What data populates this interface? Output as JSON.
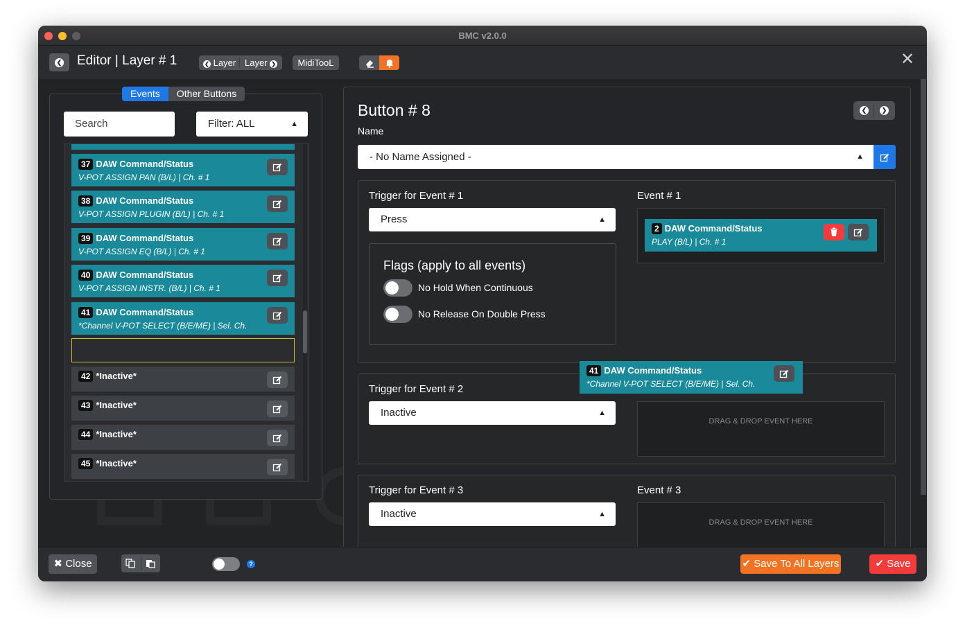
{
  "window": {
    "title": "BMC v2.0.0"
  },
  "header": {
    "editor_title": "Editor | Layer # 1",
    "layer_prev": "Layer",
    "layer_next": "Layer",
    "miditool": "MidiTooL"
  },
  "left": {
    "tabs": [
      "Events",
      "Other Buttons"
    ],
    "search_placeholder": "Search",
    "filter": "Filter: ALL",
    "events": [
      {
        "num": "37",
        "title": "DAW Command/Status",
        "sub": "V-POT ASSIGN PAN (B/L) | Ch. # 1"
      },
      {
        "num": "38",
        "title": "DAW Command/Status",
        "sub": "V-POT ASSIGN PLUGIN (B/L) | Ch. # 1"
      },
      {
        "num": "39",
        "title": "DAW Command/Status",
        "sub": "V-POT ASSIGN EQ (B/L) | Ch. # 1"
      },
      {
        "num": "40",
        "title": "DAW Command/Status",
        "sub": "V-POT ASSIGN INSTR. (B/L) | Ch. # 1"
      },
      {
        "num": "41",
        "title": "DAW Command/Status",
        "sub": "*Channel V-POT SELECT (B/E/ME) | Sel. Ch."
      }
    ],
    "inactive": [
      {
        "num": "42",
        "title": "*Inactive*"
      },
      {
        "num": "43",
        "title": "*Inactive*"
      },
      {
        "num": "44",
        "title": "*Inactive*"
      },
      {
        "num": "45",
        "title": "*Inactive*"
      }
    ]
  },
  "right": {
    "button_title": "Button # 8",
    "name_label": "Name",
    "name_value": "- No Name Assigned -",
    "trigger1_label": "Trigger for Event # 1",
    "trigger1_value": "Press",
    "event1_label": "Event # 1",
    "event1": {
      "num": "2",
      "title": "DAW Command/Status",
      "sub": "PLAY (B/L) | Ch. # 1"
    },
    "flags_title": "Flags (apply to all events)",
    "flag1": "No Hold When Continuous",
    "flag2": "No Release On Double Press",
    "trigger2_label": "Trigger for Event # 2",
    "trigger2_value": "Inactive",
    "dropzone_text": "DRAG & DROP EVENT HERE",
    "trigger3_label": "Trigger for Event # 3",
    "trigger3_value": "Inactive",
    "event3_label": "Event # 3"
  },
  "dragging": {
    "num": "41",
    "title": "DAW Command/Status",
    "sub": "*Channel V-POT SELECT (B/E/ME) | Sel. Ch."
  },
  "footer": {
    "close": "Close",
    "save_all": "Save To All Layers",
    "save": "Save",
    "help": "?"
  },
  "colors": {
    "accent": "#1e78e6",
    "event_teal": "#1a8a9a",
    "save_all": "#f37325",
    "save": "#f23b3b"
  }
}
